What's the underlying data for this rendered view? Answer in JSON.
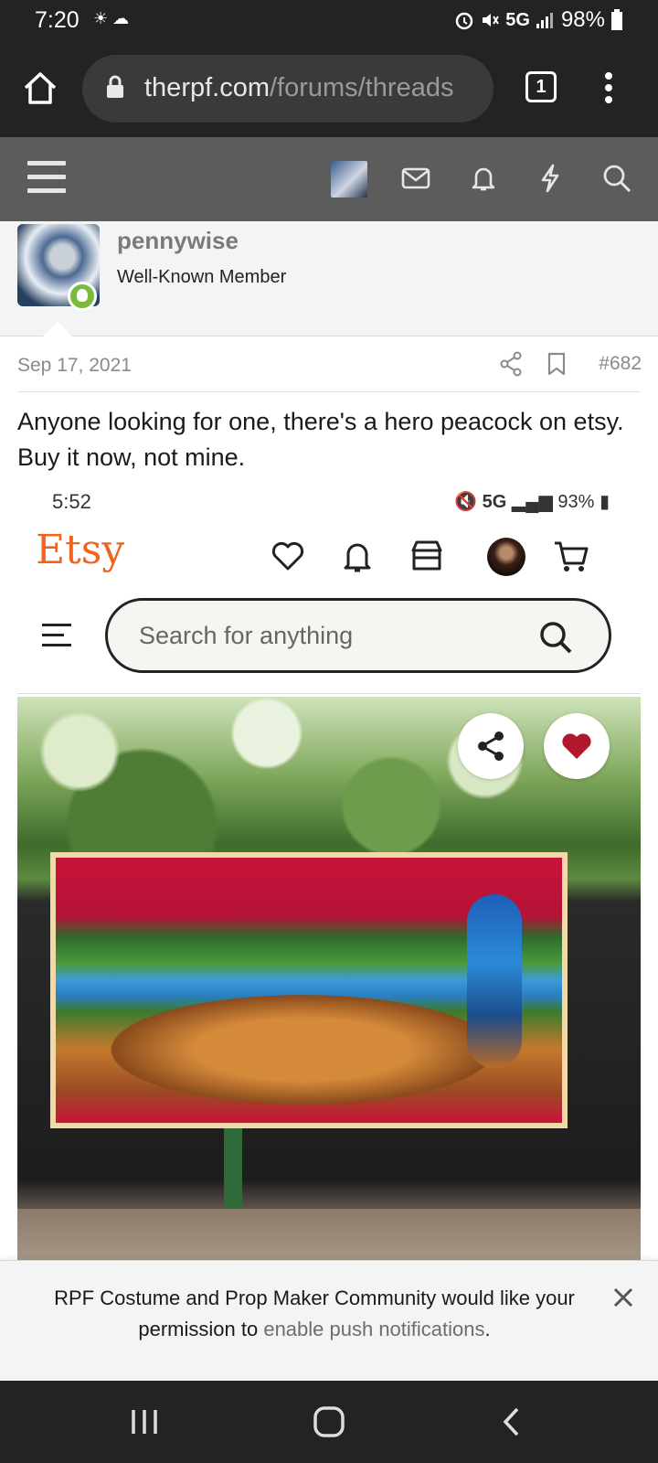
{
  "status_bar": {
    "time": "7:20",
    "weather_icons": "☀ ☁",
    "network": "5G",
    "battery": "98%"
  },
  "browser": {
    "url_domain": "therpf.com",
    "url_path": "/forums/threads",
    "tab_count": "1"
  },
  "forum_header": {
    "icons": [
      "menu-icon",
      "avatar",
      "mail-icon",
      "bell-icon",
      "lightning-icon",
      "search-icon"
    ]
  },
  "post": {
    "username": "pennywise",
    "user_title": "Well-Known Member",
    "date": "Sep 17, 2021",
    "post_number": "#682",
    "body": "Anyone looking for one, there's a hero peacock on etsy. Buy it now, not mine."
  },
  "embedded_screenshot": {
    "time": "5:52",
    "network": "5G",
    "battery": "93%",
    "logo": "Etsy",
    "search_placeholder": "Search for anything"
  },
  "notification_prompt": {
    "text_before": "RPF Costume and Prop Maker Community would like your permission to ",
    "link_text": "enable push notifications",
    "text_after": "."
  },
  "colors": {
    "forum_header": "#5c5c5c",
    "online_green": "#7bb93f",
    "etsy_orange": "#f1641e",
    "heart_red": "#b0182e"
  }
}
